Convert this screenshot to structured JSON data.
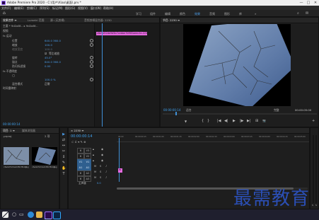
{
  "titlebar": {
    "title": "Adobe Premiere Pro 2020 - C:\\用户\\Xiao\\桌面\\.prv *",
    "min": "—",
    "max": "□",
    "close": "✕"
  },
  "menu": [
    "文件(F)",
    "编辑(E)",
    "剪辑(C)",
    "序列(S)",
    "标记(M)",
    "图形(G)",
    "视图(V)",
    "窗口(W)",
    "帮助(H)"
  ],
  "workspaces": {
    "items": [
      "学习",
      "组件",
      "编辑",
      "颜色",
      "效果",
      "音频",
      "图形",
      "库"
    ],
    "active_index": 4,
    "more": "»"
  },
  "effect_controls": {
    "tabs": [
      "效果控件 ≡",
      "Lumetri 范围",
      "源: (无剪辑)",
      "音频剪辑混合器: 2230"
    ],
    "source_line": "主要 * 9d2a8f... ▸ 9d2a8f...",
    "clip_label": "c6e9d52de9d5b7cebbe70f6f2aeec2e-2239.jpg",
    "video_header": "视频",
    "motion": "fx 运动",
    "params": [
      {
        "label": "位置",
        "value": "640.0  360.0"
      },
      {
        "label": "缩放",
        "value": "100.0"
      },
      {
        "label": "缩放宽度",
        "value": "100.0"
      },
      {
        "label": "等比缩放",
        "value": "☑"
      },
      {
        "label": "旋转",
        "value": "45.0°"
      },
      {
        "label": "锚点",
        "value": "640.0  360.0"
      },
      {
        "label": "防闪烁滤镜",
        "value": "0.00"
      }
    ],
    "opacity": "fx 不透明度",
    "opacity_value": "100.0 %",
    "blend": "混合模式",
    "blend_value": "正常",
    "time_remap": "时间重映射",
    "timecode": "00:00:00:14"
  },
  "program": {
    "title": "节目: 2230 ≡",
    "timecode_left": "00:00:00:14",
    "fit": "适合",
    "quality": "完整",
    "timecode_right": "00:00:05:00",
    "controls": [
      "▼",
      "{",
      "}",
      "|◀",
      "◀|",
      "▶",
      "|▶",
      "▶|",
      "⊞",
      "📷",
      "+"
    ]
  },
  "project": {
    "tabs": [
      "项目: 1 ≡",
      "媒体浏览器"
    ],
    "file": ".prproj",
    "count": "2 项",
    "items": [
      {
        "name": "c6e9d52de9d5b7c...jpg",
        "duration": "5:00"
      },
      {
        "name": "c6e9d52de9d5b7c...jpg",
        "duration": "5:00"
      }
    ]
  },
  "timeline": {
    "tab": "× 2230 ≡",
    "timecode": "00:00:00:14",
    "ruler": [
      "00:00",
      "00:00:00:15",
      "00:00:01:00",
      "00:00:01:15",
      "00:00:02:00",
      "00:00:02:15",
      "00:00:03:00",
      "00:00:03:15",
      "00:00:04:00",
      "00:00:04:15",
      "00:00:05:00"
    ],
    "tracks": [
      {
        "toggle": "6",
        "label": "V3"
      },
      {
        "toggle": "6",
        "label": "V2"
      },
      {
        "toggle": "V1",
        "label": "V1"
      },
      {
        "toggle": "A1",
        "label": "A1"
      },
      {
        "toggle": "6",
        "label": "A2"
      },
      {
        "toggle": "6",
        "label": "A3"
      }
    ],
    "master": "主声道",
    "master_value": "0.0",
    "clip_label": "fx"
  },
  "tools": [
    "▶",
    "⇄",
    "↔",
    "✂",
    "↕",
    "✎",
    "✋",
    "T"
  ],
  "watermark": "最需教育",
  "taskbar": {
    "time": "",
    "search_placeholder": ""
  },
  "colors": {
    "accent": "#4a9ce8",
    "clip": "#e66be0",
    "bg": "#1e1e1e"
  }
}
